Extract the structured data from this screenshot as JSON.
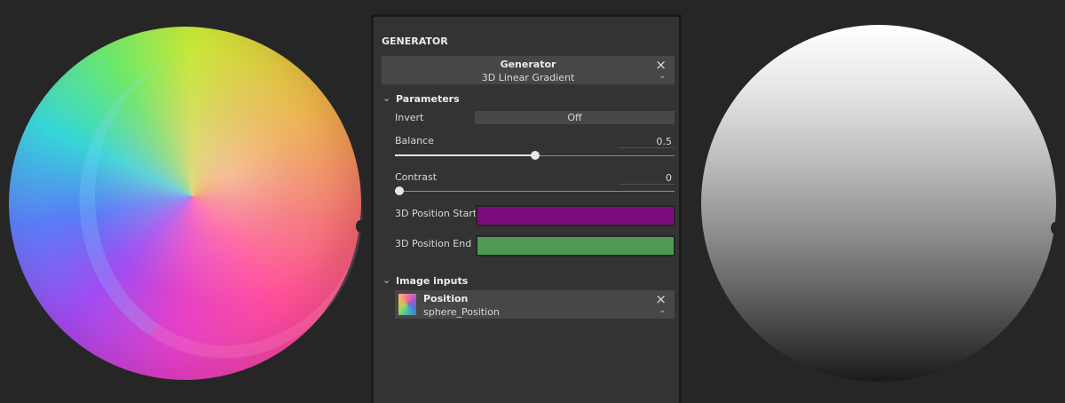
{
  "panel": {
    "title": "GENERATOR",
    "generator": {
      "label": "Generator",
      "selected": "3D Linear Gradient"
    },
    "parameters": {
      "section_label": "Parameters",
      "invert": {
        "label": "Invert",
        "value": "Off"
      },
      "balance": {
        "label": "Balance",
        "value": "0.5",
        "fraction": 0.5
      },
      "contrast": {
        "label": "Contrast",
        "value": "0",
        "fraction": 0
      },
      "position_start": {
        "label": "3D Position Start",
        "color": "#7d0a7d"
      },
      "position_end": {
        "label": "3D Position End",
        "color": "#4f9a52"
      }
    },
    "image_inputs": {
      "section_label": "Image inputs",
      "input": {
        "label": "Position",
        "selected": "sphere_Position"
      }
    }
  },
  "icons": {
    "close": "×",
    "chevron_down": "⌄"
  }
}
